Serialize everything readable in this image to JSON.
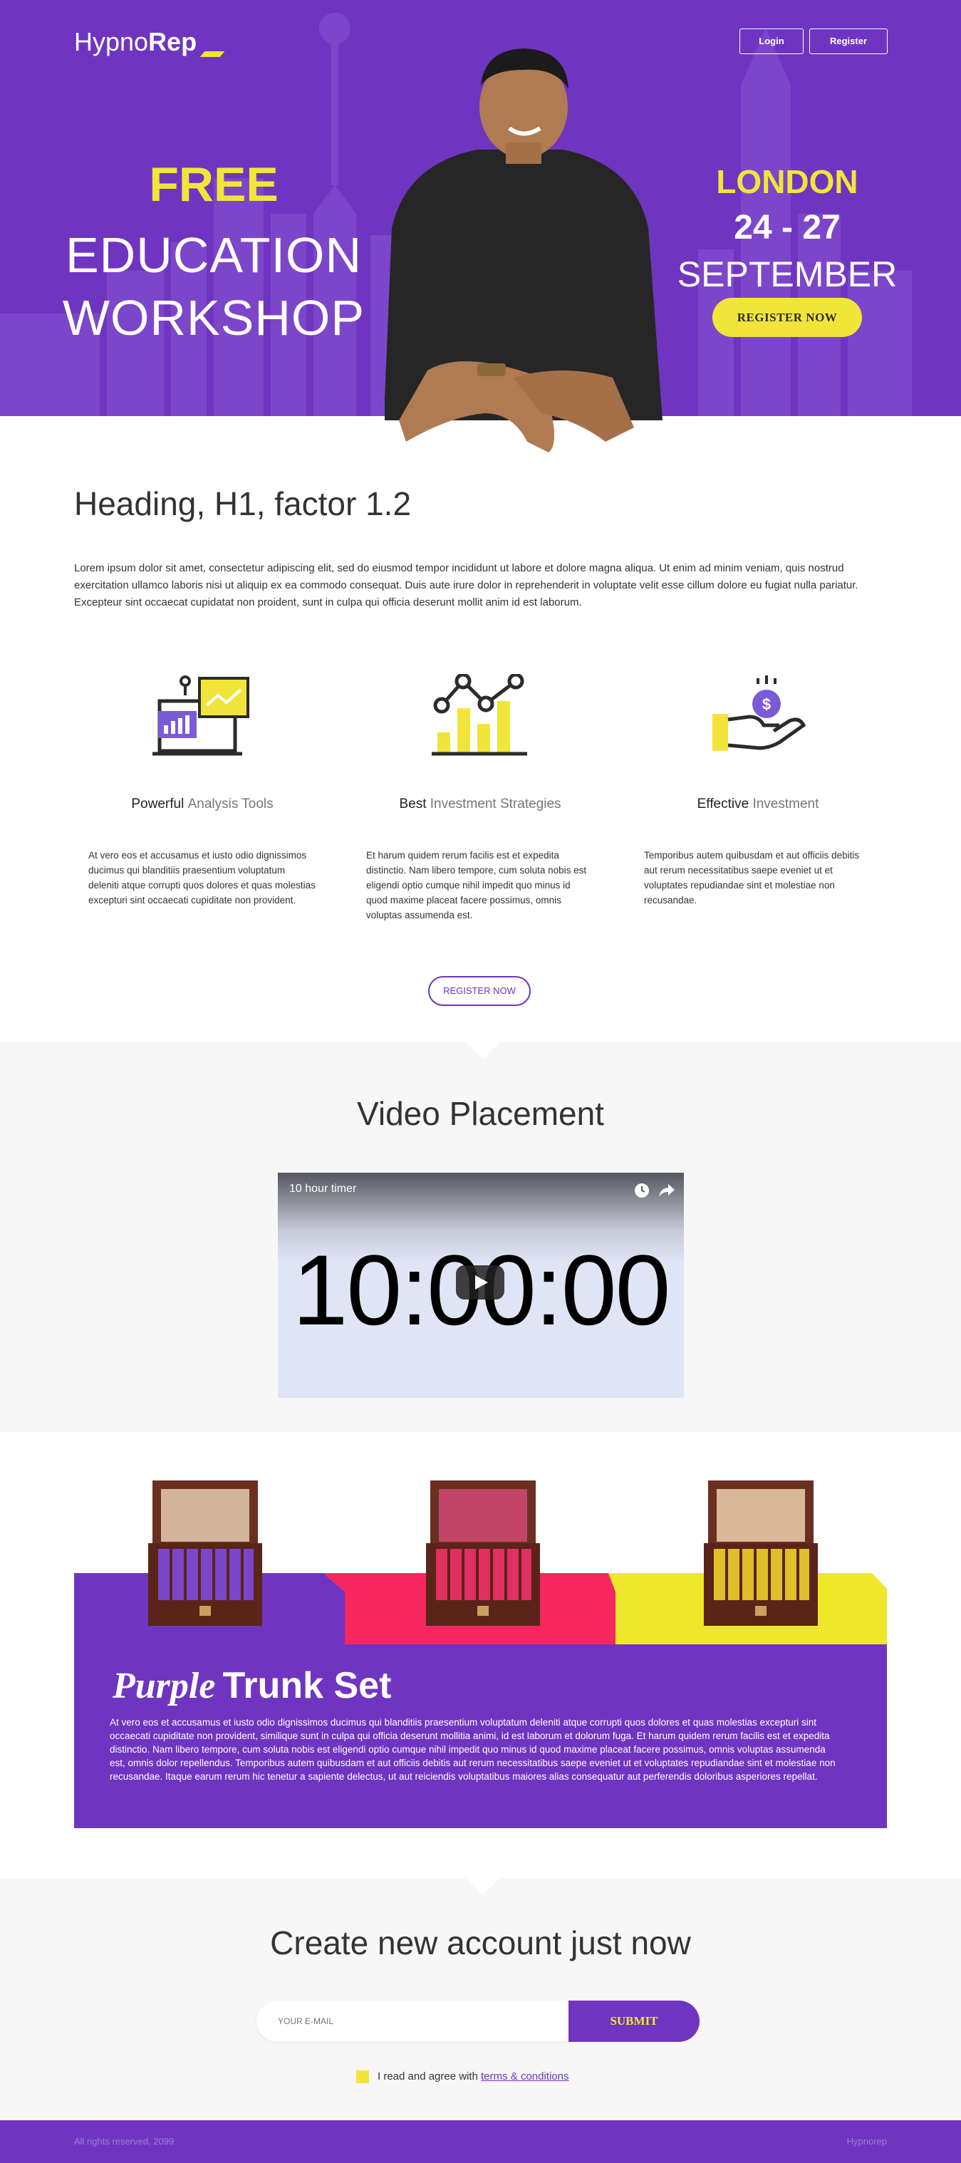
{
  "header": {
    "logo_light": "Hypno",
    "logo_bold": "Rep",
    "login_label": "Login",
    "register_label": "Register"
  },
  "hero": {
    "free": "FREE",
    "line1": "EDUCATION",
    "line2": "WORKSHOP",
    "city": "LONDON",
    "dates": "24 - 27",
    "month": "SEPTEMBER",
    "cta": "REGISTER NOW"
  },
  "intro": {
    "heading": "Heading, H1, factor 1.2",
    "text": "Lorem ipsum dolor sit amet, consectetur adipiscing elit, sed do eiusmod tempor incididunt ut labore et dolore magna aliqua. Ut enim ad minim veniam, quis nostrud exercitation ullamco laboris nisi ut aliquip ex ea commodo consequat. Duis aute irure dolor in reprehenderit in voluptate velit esse cillum dolore eu fugiat nulla pariatur. Excepteur sint occaecat cupidatat non proident, sunt in culpa qui officia deserunt mollit anim id est laborum."
  },
  "features": [
    {
      "bold": "Powerful",
      "light": "Analysis Tools",
      "icon": "analysis-tools-icon",
      "text": "At vero eos et accusamus et iusto odio dignissimos ducimus qui blanditiis praesentium voluptatum deleniti atque corrupti quos dolores et quas molestias excepturi sint occaecati cupiditate non provident."
    },
    {
      "bold": "Best",
      "light": "Investment Strategies",
      "icon": "chart-growth-icon",
      "text": "Et harum quidem rerum facilis est et expedita distinctio. Nam libero tempore, cum soluta nobis est eligendi optio cumque nihil impedit quo minus id quod maxime placeat facere possimus, omnis voluptas assumenda est."
    },
    {
      "bold": "Effective",
      "light": "Investment",
      "icon": "money-hand-icon",
      "text": "Temporibus autem quibusdam et aut officiis debitis aut rerum necessitatibus saepe eveniet ut et voluptates repudiandae sint et molestiae non recusandae."
    }
  ],
  "register_outline": "REGISTER NOW",
  "video": {
    "title": "Video Placement",
    "caption": "10 hour timer",
    "timer": "10:00:00"
  },
  "trunk": {
    "title_italic": "Purple",
    "title_bold": "Trunk Set",
    "text": "At vero eos et accusamus et iusto odio dignissimos ducimus qui blanditiis praesentium voluptatum deleniti atque corrupti quos dolores et quas molestias excepturi sint occaecati cupiditate non provident, similique sunt in culpa qui officia deserunt mollitia animi, id est laborum et dolorum fuga. Et harum quidem rerum facilis est et expedita distinctio. Nam libero tempore, cum soluta nobis est eligendi optio cumque nihil impedit quo minus id quod maxime placeat facere possimus, omnis voluptas assumenda est, omnis dolor repellendus. Temporibus autem quibusdam et aut officiis debitis aut rerum necessitatibus saepe eveniet ut et voluptates repudiandae sint et molestiae non recusandae. Itaque earum rerum hic tenetur a sapiente delectus, ut aut reiciendis voluptatibus maiores alias consequatur aut perferendis doloribus asperiores repellat.",
    "colors": [
      "#6f35c0",
      "#f5275e",
      "#efe82a"
    ]
  },
  "signup": {
    "title": "Create new account just now",
    "email_placeholder": "YOUR E-MAIL",
    "submit": "SUBMIT",
    "agree_prefix": "I read and agree with",
    "terms": "terms & conditions"
  },
  "footer": {
    "copyright": "All rights reserved, 2099",
    "brand": "Hypnorep"
  },
  "colors": {
    "purple": "#6f35c0",
    "yellow": "#f2e53a",
    "pink": "#f5275e"
  }
}
